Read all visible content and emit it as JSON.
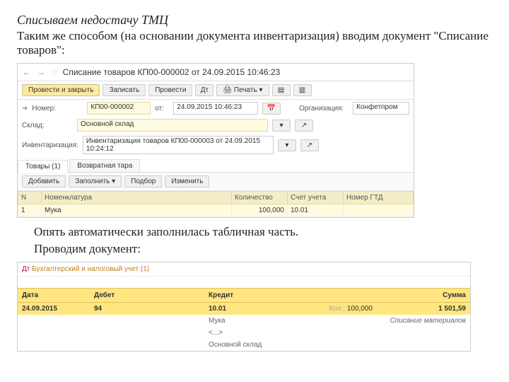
{
  "heading": {
    "line1": "Списываем недостачу ТМЦ",
    "line2": "Таким же способом (на основании документа инвентаризация) вводим документ \"Списание товаров\":"
  },
  "s1": {
    "title": "Списание товаров КП00-000002 от 24.09.2015 10:46:23",
    "toolbar": {
      "post_close": "Провести и закрыть",
      "save": "Записать",
      "post": "Провести",
      "print": "Печать"
    },
    "fields": {
      "number_label": "Номер:",
      "number_value": "КП00-000002",
      "date_label": "от:",
      "date_value": "24.09.2015 10:46:23",
      "org_label": "Организация:",
      "org_value": "Конфетпром",
      "warehouse_label": "Склад:",
      "warehouse_value": "Основной склад",
      "inv_label": "Инвентаризация:",
      "inv_value": "Инвентаризация товаров КП00-000003 от 24.09.2015 10:24:12"
    },
    "tabs": {
      "t1": "Товары (1)",
      "t2": "Возвратная тара"
    },
    "subtool": {
      "add": "Добавить",
      "fill": "Заполнить",
      "pick": "Подбор",
      "change": "Изменить"
    },
    "cols": {
      "n": "N",
      "nom": "Номенклатура",
      "qty": "Количество",
      "acct": "Счет учета",
      "gtd": "Номер ГТД"
    },
    "row": {
      "n": "1",
      "nom": "Мука",
      "qty": "100,000",
      "acct": "10.01",
      "gtd": ""
    }
  },
  "midtext": {
    "line1": "Опять автоматически заполнилась табличная часть.",
    "line2": "Проводим документ:"
  },
  "s2": {
    "title": "Бухгалтерский и налоговый учет (1)",
    "cols": {
      "date": "Дата",
      "debit": "Дебет",
      "credit": "Кредит",
      "sum": "Сумма"
    },
    "row1": {
      "date": "24.09.2015",
      "debit": "94",
      "credit": "10.01",
      "credit_qty_lbl": "Кол.:",
      "credit_qty": "100,000",
      "sum": "1 501,59"
    },
    "row2": {
      "nom": "Мука",
      "desc": "Списание материалов"
    },
    "row3": {
      "blank": "<...>"
    },
    "row4": {
      "wh": "Основной склад"
    }
  }
}
